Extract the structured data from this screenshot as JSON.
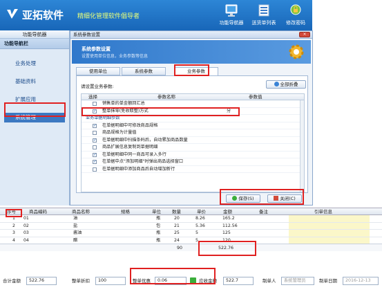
{
  "header": {
    "app_name": "亚拓软件",
    "slogan": "精细化管理软件倡导者",
    "toolbar": [
      {
        "label": "功能导航器",
        "icon": "monitor-icon"
      },
      {
        "label": "送货单列表",
        "icon": "list-icon"
      },
      {
        "label": "修改密码",
        "icon": "password-icon"
      }
    ]
  },
  "nav": {
    "tab_label": "功能导航器",
    "title": "功能导航栏",
    "items": [
      "业务处理",
      "基础资料",
      "扩展应用",
      "系统管理"
    ],
    "active_index": 3
  },
  "dialog": {
    "title": "系统参数设置",
    "close_label": "×",
    "banner_title": "系统参数设置",
    "banner_subtitle": "设置使用单位信息，业务参数等信息",
    "tabs": [
      "使用单位",
      "系统参数",
      "业务参数"
    ],
    "active_tab": 2,
    "prompt": "请设置业务参数:",
    "expand_all_label": "全部折叠",
    "columns": {
      "select": "选择",
      "name": "参数名称",
      "value": "参数值"
    },
    "rows": [
      {
        "type": "param",
        "checked": false,
        "label": "销售单的单金额回汇总",
        "value": ""
      },
      {
        "type": "param",
        "checked": true,
        "label": "整单抹零(免收取整)方式",
        "value": "分"
      },
      {
        "type": "group",
        "label": "业务单据明细参数"
      },
      {
        "type": "param",
        "checked": true,
        "label": "在单据明细中可修改商品规格",
        "value": ""
      },
      {
        "type": "param",
        "checked": false,
        "label": "商品规格为计量值",
        "value": ""
      },
      {
        "type": "param",
        "checked": true,
        "label": "在单据明细中扫描条码后，自动累加商品数量",
        "value": ""
      },
      {
        "type": "param",
        "checked": false,
        "label": "商品扩展信息复制到单据明细",
        "value": ""
      },
      {
        "type": "param",
        "checked": true,
        "label": "在单据明细中同一商品可录入多行",
        "value": ""
      },
      {
        "type": "param",
        "checked": true,
        "label": "在单据中点\"添加明细\"时弹出商品选择窗口",
        "value": ""
      },
      {
        "type": "param",
        "checked": false,
        "label": "在单据明细中添加商品后自动增加新行",
        "value": ""
      }
    ],
    "save_label": "保存(S)",
    "close_button_label": "关闭(C)"
  },
  "order": {
    "columns": [
      "序号",
      "商品编码",
      "商品名称",
      "规格",
      "单位",
      "数量",
      "单价",
      "金额",
      "备注",
      "引单信息"
    ],
    "rows": [
      {
        "seq": "1",
        "code": "01",
        "name": "油",
        "spec": "",
        "unit": "瓶",
        "qty": "20",
        "price": "8.26",
        "amount": "165.2",
        "note": ""
      },
      {
        "seq": "2",
        "code": "02",
        "name": "盐",
        "spec": "",
        "unit": "包",
        "qty": "21",
        "price": "5.36",
        "amount": "112.56",
        "note": ""
      },
      {
        "seq": "3",
        "code": "03",
        "name": "酱油",
        "spec": "",
        "unit": "瓶",
        "qty": "25",
        "price": "5",
        "amount": "125",
        "note": ""
      },
      {
        "seq": "4",
        "code": "04",
        "name": "醋",
        "spec": "",
        "unit": "瓶",
        "qty": "24",
        "price": "5",
        "amount": "120",
        "note": ""
      }
    ],
    "total_qty": "90",
    "total_amount": "522.76"
  },
  "footer": {
    "total_label": "合计金额",
    "total_value": "522.76",
    "discount_label": "整单折扣",
    "discount_value": "100",
    "adjust_label": "整单优惠",
    "adjust_value": "0.06",
    "receivable_label": "应收金额",
    "receivable_value": "522.7",
    "maker_label": "制单人",
    "maker_value": "系统管理员",
    "date_label": "制单日期",
    "date_value": "2016-12-13"
  },
  "colors": {
    "accent": "#1866b8",
    "highlight": "#e02020",
    "note_column": "#fbf7c9"
  }
}
